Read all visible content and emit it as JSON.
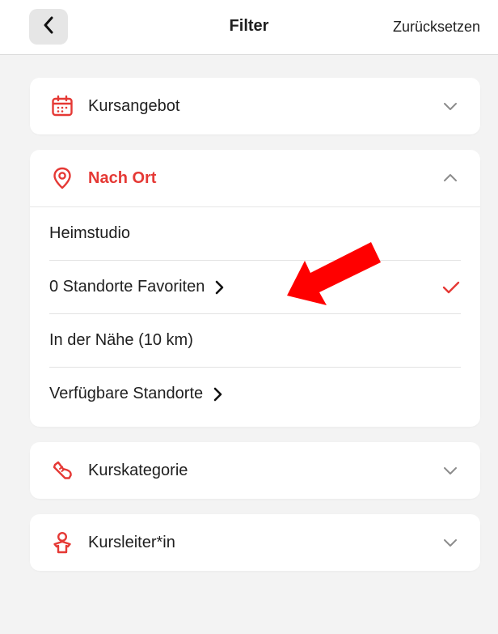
{
  "header": {
    "title": "Filter",
    "reset_label": "Zurücksetzen"
  },
  "sections": {
    "kursangebot": {
      "label": "Kursangebot"
    },
    "nach_ort": {
      "label": "Nach Ort",
      "options": [
        {
          "label": "Heimstudio",
          "has_arrow": false,
          "selected": false
        },
        {
          "label": "0 Standorte Favoriten",
          "has_arrow": true,
          "selected": true
        },
        {
          "label": "In der Nähe (10 km)",
          "has_arrow": false,
          "selected": false
        },
        {
          "label": "Verfügbare Standorte",
          "has_arrow": true,
          "selected": false
        }
      ]
    },
    "kurskategorie": {
      "label": "Kurskategorie"
    },
    "kursleiter": {
      "label": "Kursleiter*in"
    }
  },
  "colors": {
    "accent": "#e53935",
    "background": "#f3f3f3",
    "annotation_arrow": "#ff0000"
  },
  "icons": {
    "back": "chevron-left-icon",
    "kursangebot": "calendar-icon",
    "nach_ort": "location-pin-icon",
    "kurskategorie": "shoe-icon",
    "kursleiter": "person-icon"
  }
}
